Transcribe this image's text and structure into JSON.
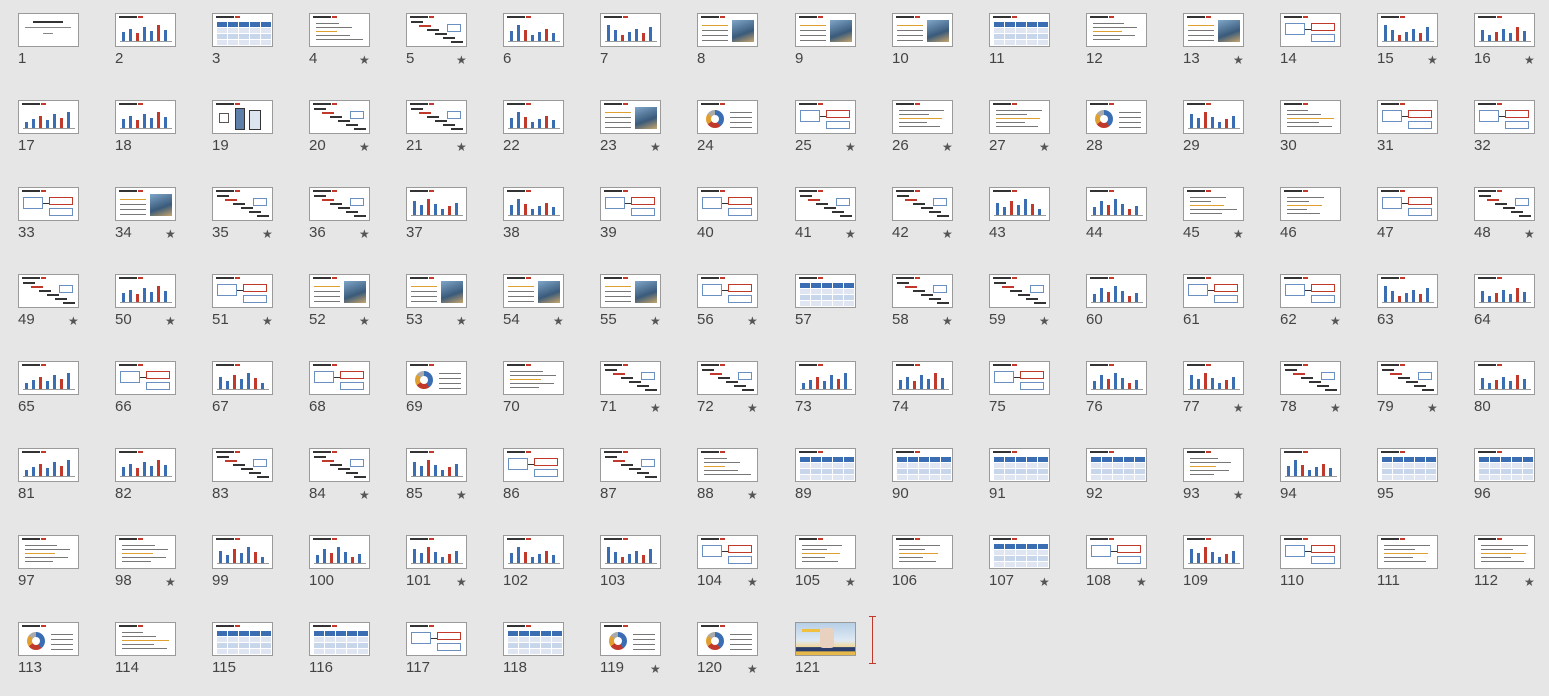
{
  "slides": [
    {
      "n": "1",
      "s": false,
      "k": "title"
    },
    {
      "n": "2",
      "s": false,
      "k": "bars"
    },
    {
      "n": "3",
      "s": false,
      "k": "table"
    },
    {
      "n": "4",
      "s": true,
      "k": "text"
    },
    {
      "n": "5",
      "s": true,
      "k": "stairs"
    },
    {
      "n": "6",
      "s": false,
      "k": "bars"
    },
    {
      "n": "7",
      "s": false,
      "k": "bars"
    },
    {
      "n": "8",
      "s": false,
      "k": "photo"
    },
    {
      "n": "9",
      "s": false,
      "k": "photo"
    },
    {
      "n": "10",
      "s": false,
      "k": "photo"
    },
    {
      "n": "11",
      "s": false,
      "k": "table"
    },
    {
      "n": "12",
      "s": false,
      "k": "text"
    },
    {
      "n": "13",
      "s": true,
      "k": "photo"
    },
    {
      "n": "14",
      "s": false,
      "k": "boxes"
    },
    {
      "n": "15",
      "s": true,
      "k": "bars"
    },
    {
      "n": "16",
      "s": true,
      "k": "bars"
    },
    {
      "n": "17",
      "s": false,
      "k": "bars"
    },
    {
      "n": "18",
      "s": false,
      "k": "bars"
    },
    {
      "n": "19",
      "s": false,
      "k": "phone"
    },
    {
      "n": "20",
      "s": true,
      "k": "stairs"
    },
    {
      "n": "21",
      "s": true,
      "k": "stairs"
    },
    {
      "n": "22",
      "s": false,
      "k": "bars"
    },
    {
      "n": "23",
      "s": true,
      "k": "photo"
    },
    {
      "n": "24",
      "s": false,
      "k": "pie"
    },
    {
      "n": "25",
      "s": true,
      "k": "boxes"
    },
    {
      "n": "26",
      "s": true,
      "k": "text"
    },
    {
      "n": "27",
      "s": true,
      "k": "text"
    },
    {
      "n": "28",
      "s": false,
      "k": "pie"
    },
    {
      "n": "29",
      "s": false,
      "k": "bars"
    },
    {
      "n": "30",
      "s": false,
      "k": "text"
    },
    {
      "n": "31",
      "s": false,
      "k": "boxes"
    },
    {
      "n": "32",
      "s": false,
      "k": "boxes"
    },
    {
      "n": "33",
      "s": false,
      "k": "boxes"
    },
    {
      "n": "34",
      "s": true,
      "k": "photo"
    },
    {
      "n": "35",
      "s": true,
      "k": "stairs"
    },
    {
      "n": "36",
      "s": true,
      "k": "stairs"
    },
    {
      "n": "37",
      "s": false,
      "k": "bars"
    },
    {
      "n": "38",
      "s": false,
      "k": "bars"
    },
    {
      "n": "39",
      "s": false,
      "k": "boxes"
    },
    {
      "n": "40",
      "s": false,
      "k": "boxes"
    },
    {
      "n": "41",
      "s": true,
      "k": "stairs"
    },
    {
      "n": "42",
      "s": true,
      "k": "stairs"
    },
    {
      "n": "43",
      "s": false,
      "k": "bars"
    },
    {
      "n": "44",
      "s": false,
      "k": "bars"
    },
    {
      "n": "45",
      "s": true,
      "k": "text"
    },
    {
      "n": "46",
      "s": false,
      "k": "text"
    },
    {
      "n": "47",
      "s": false,
      "k": "boxes"
    },
    {
      "n": "48",
      "s": true,
      "k": "stairs"
    },
    {
      "n": "49",
      "s": true,
      "k": "stairs"
    },
    {
      "n": "50",
      "s": true,
      "k": "bars"
    },
    {
      "n": "51",
      "s": true,
      "k": "boxes"
    },
    {
      "n": "52",
      "s": true,
      "k": "photo"
    },
    {
      "n": "53",
      "s": true,
      "k": "photo"
    },
    {
      "n": "54",
      "s": true,
      "k": "photo"
    },
    {
      "n": "55",
      "s": true,
      "k": "photo"
    },
    {
      "n": "56",
      "s": true,
      "k": "boxes"
    },
    {
      "n": "57",
      "s": false,
      "k": "table"
    },
    {
      "n": "58",
      "s": true,
      "k": "stairs"
    },
    {
      "n": "59",
      "s": true,
      "k": "stairs"
    },
    {
      "n": "60",
      "s": false,
      "k": "bars"
    },
    {
      "n": "61",
      "s": false,
      "k": "boxes"
    },
    {
      "n": "62",
      "s": true,
      "k": "boxes"
    },
    {
      "n": "63",
      "s": false,
      "k": "bars"
    },
    {
      "n": "64",
      "s": false,
      "k": "bars"
    },
    {
      "n": "65",
      "s": false,
      "k": "bars"
    },
    {
      "n": "66",
      "s": false,
      "k": "boxes"
    },
    {
      "n": "67",
      "s": false,
      "k": "bars"
    },
    {
      "n": "68",
      "s": false,
      "k": "boxes"
    },
    {
      "n": "69",
      "s": false,
      "k": "pie"
    },
    {
      "n": "70",
      "s": false,
      "k": "text"
    },
    {
      "n": "71",
      "s": true,
      "k": "stairs"
    },
    {
      "n": "72",
      "s": true,
      "k": "stairs"
    },
    {
      "n": "73",
      "s": false,
      "k": "bars"
    },
    {
      "n": "74",
      "s": false,
      "k": "bars"
    },
    {
      "n": "75",
      "s": false,
      "k": "boxes"
    },
    {
      "n": "76",
      "s": false,
      "k": "bars"
    },
    {
      "n": "77",
      "s": true,
      "k": "bars"
    },
    {
      "n": "78",
      "s": true,
      "k": "stairs"
    },
    {
      "n": "79",
      "s": true,
      "k": "stairs"
    },
    {
      "n": "80",
      "s": false,
      "k": "bars"
    },
    {
      "n": "81",
      "s": false,
      "k": "bars"
    },
    {
      "n": "82",
      "s": false,
      "k": "bars"
    },
    {
      "n": "83",
      "s": false,
      "k": "stairs"
    },
    {
      "n": "84",
      "s": true,
      "k": "stairs"
    },
    {
      "n": "85",
      "s": true,
      "k": "bars"
    },
    {
      "n": "86",
      "s": false,
      "k": "boxes"
    },
    {
      "n": "87",
      "s": false,
      "k": "stairs"
    },
    {
      "n": "88",
      "s": true,
      "k": "text"
    },
    {
      "n": "89",
      "s": false,
      "k": "table"
    },
    {
      "n": "90",
      "s": false,
      "k": "table"
    },
    {
      "n": "91",
      "s": false,
      "k": "table"
    },
    {
      "n": "92",
      "s": false,
      "k": "table"
    },
    {
      "n": "93",
      "s": true,
      "k": "text"
    },
    {
      "n": "94",
      "s": false,
      "k": "bars"
    },
    {
      "n": "95",
      "s": false,
      "k": "table"
    },
    {
      "n": "96",
      "s": false,
      "k": "table"
    },
    {
      "n": "97",
      "s": false,
      "k": "text"
    },
    {
      "n": "98",
      "s": true,
      "k": "text"
    },
    {
      "n": "99",
      "s": false,
      "k": "bars"
    },
    {
      "n": "100",
      "s": false,
      "k": "bars"
    },
    {
      "n": "101",
      "s": true,
      "k": "bars"
    },
    {
      "n": "102",
      "s": false,
      "k": "bars"
    },
    {
      "n": "103",
      "s": false,
      "k": "bars"
    },
    {
      "n": "104",
      "s": true,
      "k": "boxes"
    },
    {
      "n": "105",
      "s": true,
      "k": "text"
    },
    {
      "n": "106",
      "s": false,
      "k": "text"
    },
    {
      "n": "107",
      "s": true,
      "k": "table"
    },
    {
      "n": "108",
      "s": true,
      "k": "boxes"
    },
    {
      "n": "109",
      "s": false,
      "k": "bars"
    },
    {
      "n": "110",
      "s": false,
      "k": "boxes"
    },
    {
      "n": "111",
      "s": false,
      "k": "text"
    },
    {
      "n": "112",
      "s": true,
      "k": "text"
    },
    {
      "n": "113",
      "s": false,
      "k": "pie"
    },
    {
      "n": "114",
      "s": false,
      "k": "text"
    },
    {
      "n": "115",
      "s": false,
      "k": "table"
    },
    {
      "n": "116",
      "s": false,
      "k": "table"
    },
    {
      "n": "117",
      "s": false,
      "k": "boxes"
    },
    {
      "n": "118",
      "s": false,
      "k": "table"
    },
    {
      "n": "119",
      "s": true,
      "k": "pie"
    },
    {
      "n": "120",
      "s": true,
      "k": "pie"
    },
    {
      "n": "121",
      "s": false,
      "k": "cover"
    }
  ],
  "star_glyph": "★",
  "colors": {
    "blue": "#3b6db3",
    "red": "#c0392b",
    "orange": "#e0a030",
    "green": "#5a9a4a",
    "dark": "#333333"
  }
}
